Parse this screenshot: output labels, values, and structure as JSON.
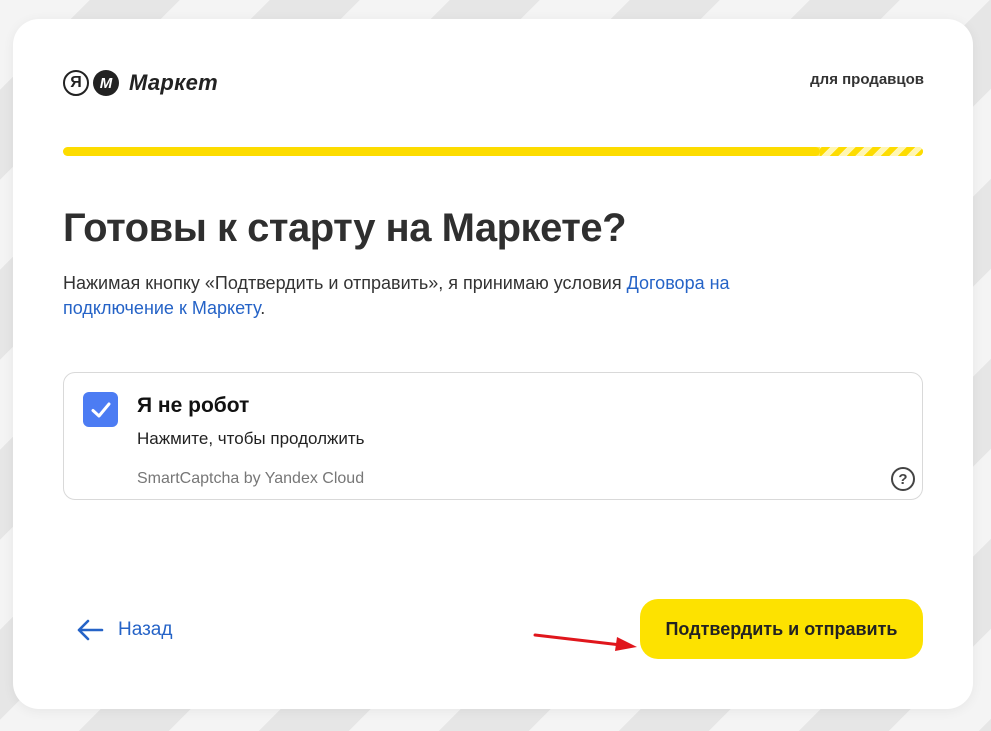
{
  "header": {
    "logo_prefix": "Я",
    "logo_m": "M",
    "logo_word": "Маркет",
    "sellers_link": "для продавцов"
  },
  "progress": {
    "value": 0.88,
    "color": "#fddc00"
  },
  "main": {
    "title": "Готовы к старту на Маркете?",
    "agreement_text": "Нажимая кнопку «Подтвердить и отправить», я принимаю условия ",
    "agreement_link": "Договора на подключение к Маркету",
    "agreement_end": "."
  },
  "captcha": {
    "checked": true,
    "title": "Я не робот",
    "subtitle": "Нажмите, чтобы продолжить",
    "brand": "SmartCaptcha by Yandex Cloud",
    "help_icon": "?"
  },
  "footer": {
    "back_label": "Назад",
    "submit_label": "Подтвердить и отправить"
  },
  "colors": {
    "accent_yellow": "#fde200",
    "link_blue": "#2563c7",
    "checkbox_blue": "#4c7cf3",
    "annotation_red": "#e0161c"
  },
  "icons": {
    "back": "arrow-left-icon",
    "check": "checkmark-icon",
    "help": "question-circle-icon"
  }
}
